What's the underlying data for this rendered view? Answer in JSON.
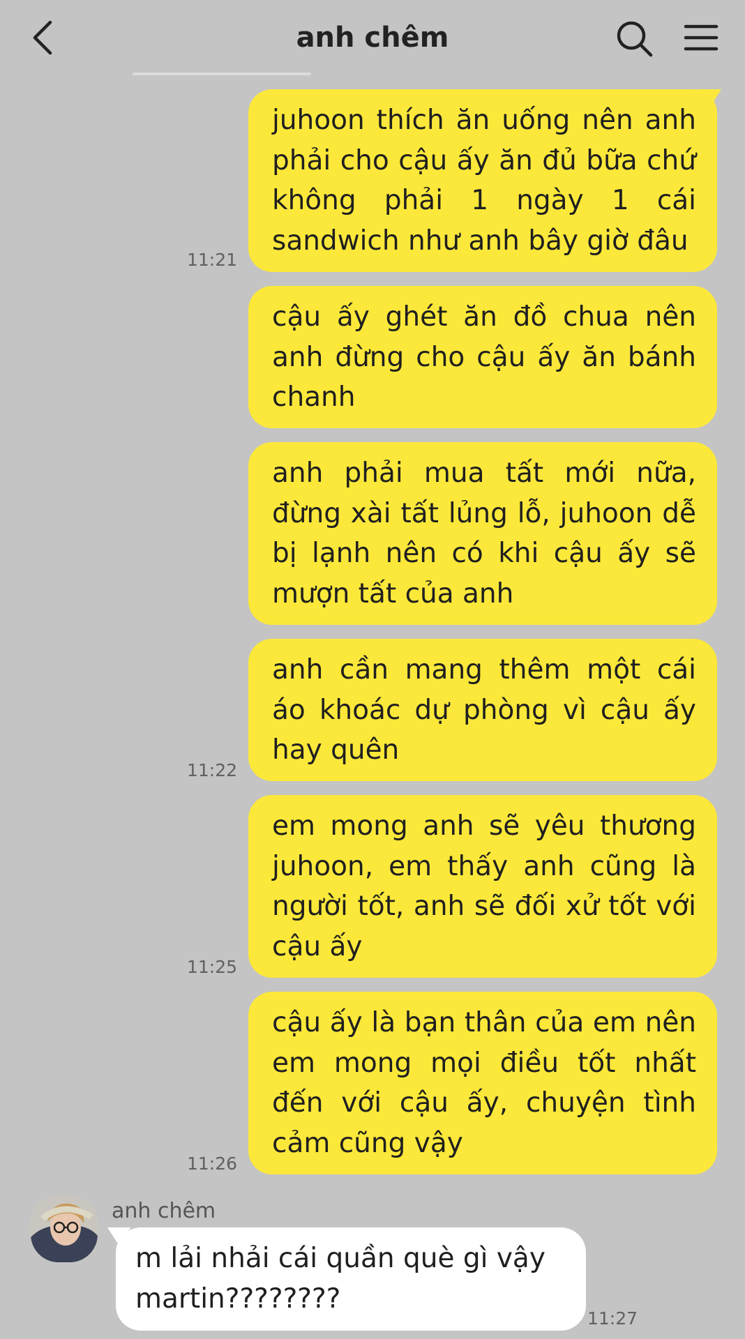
{
  "header": {
    "title": "anh chêm",
    "back_icon": "chevron-left-icon",
    "search_icon": "search-icon",
    "menu_icon": "hamburger-menu-icon"
  },
  "messages": [
    {
      "sender": "me",
      "text": "juhoon thích ăn uống nên anh phải cho cậu ấy ăn đủ bữa chứ không phải 1 ngày 1 cái sandwich như anh bây giờ đâu",
      "time": "11:21"
    },
    {
      "sender": "me",
      "text": "cậu ấy ghét ăn đồ chua nên anh đừng cho cậu ấy ăn bánh chanh",
      "time": ""
    },
    {
      "sender": "me",
      "text": "anh phải mua tất mới nữa, đừng xài tất lủng lỗ, juhoon dễ bị lạnh nên có khi cậu ấy sẽ mượn tất của anh",
      "time": ""
    },
    {
      "sender": "me",
      "text": "anh cần mang thêm một cái áo khoác dự phòng vì cậu ấy hay quên",
      "time": "11:22"
    },
    {
      "sender": "me",
      "text": "em mong anh sẽ yêu thương juhoon, em thấy anh cũng là người tốt, anh sẽ đối xử tốt với cậu ấy",
      "time": "11:25"
    },
    {
      "sender": "me",
      "text": "cậu ấy là bạn thân của em nên em mong mọi điều tốt nhất đến với cậu ấy, chuyện tình cảm cũng vậy",
      "time": "11:26"
    },
    {
      "sender": "them",
      "name": "anh chêm",
      "text": "m lải nhải cái quần què gì vậy martin????????",
      "time": "11:27"
    }
  ],
  "colors": {
    "background": "#c4c4c4",
    "my_bubble": "#fce83a",
    "their_bubble": "#ffffff"
  }
}
